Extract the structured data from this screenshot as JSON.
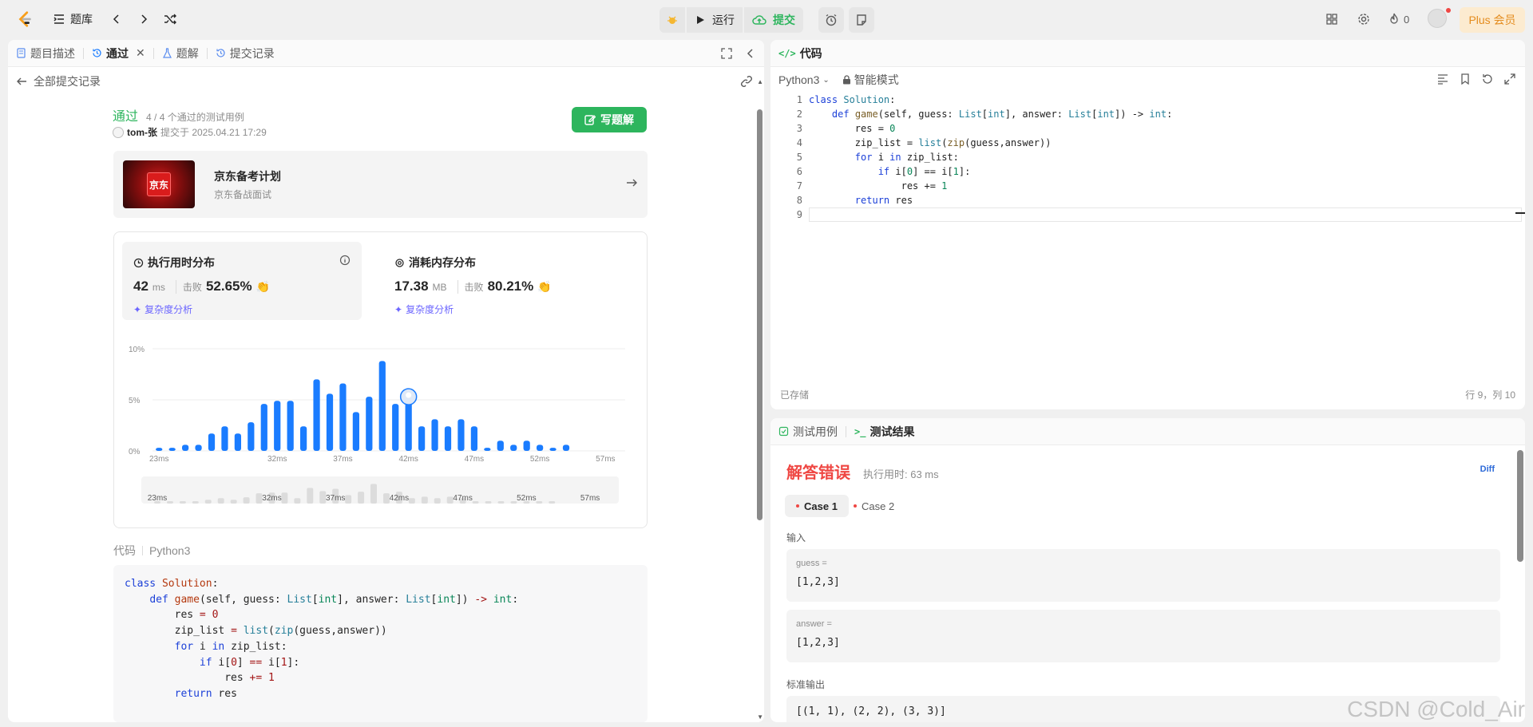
{
  "topbar": {
    "problem_list": "题库",
    "run": "运行",
    "submit": "提交",
    "streak": "0",
    "plus": "Plus 会员"
  },
  "left": {
    "tabs": [
      "题目描述",
      "通过",
      "题解",
      "提交记录"
    ],
    "back": "全部提交记录",
    "status": "通过",
    "cases": "4 / 4 个通过的测试用例",
    "user": "tom-张",
    "submitted": "提交于 2025.04.21 17:29",
    "write_solution": "写题解",
    "promo": {
      "title": "京东备考计划",
      "sub": "京东备战面试",
      "logo": "京东"
    },
    "runtime": {
      "title": "执行用时分布",
      "value": "42",
      "unit": "ms",
      "beat_label": "击败",
      "beat": "52.65%",
      "link": "复杂度分析"
    },
    "memory": {
      "title": "消耗内存分布",
      "value": "17.38",
      "unit": "MB",
      "beat_label": "击败",
      "beat": "80.21%",
      "link": "复杂度分析"
    },
    "code_label": "代码",
    "code_lang": "Python3"
  },
  "chart_data": {
    "type": "bar",
    "x": [
      "23ms",
      "24ms",
      "25ms",
      "26ms",
      "27ms",
      "28ms",
      "29ms",
      "30ms",
      "31ms",
      "32ms",
      "33ms",
      "34ms",
      "35ms",
      "36ms",
      "37ms",
      "38ms",
      "39ms",
      "40ms",
      "41ms",
      "42ms",
      "43ms",
      "44ms",
      "45ms",
      "46ms",
      "47ms",
      "48ms",
      "49ms",
      "50ms",
      "51ms",
      "52ms",
      "53ms",
      "54ms",
      "55ms",
      "56ms",
      "57ms",
      "58ms"
    ],
    "values": [
      0.3,
      0.3,
      0.6,
      0.6,
      1.7,
      2.4,
      1.7,
      2.8,
      4.6,
      4.9,
      4.9,
      2.4,
      7.0,
      5.6,
      6.6,
      3.8,
      5.3,
      8.8,
      4.6,
      5.3,
      2.4,
      3.1,
      2.4,
      3.1,
      2.4,
      0.3,
      1.0,
      0.6,
      1.0,
      0.6,
      0.3,
      0.6,
      0,
      0,
      0,
      0
    ],
    "tick_labels": [
      "23ms",
      "32ms",
      "37ms",
      "42ms",
      "47ms",
      "52ms",
      "57ms"
    ],
    "y_ticks": [
      "0%",
      "5%",
      "10%"
    ],
    "ylim": [
      0,
      10
    ],
    "marker_at": "42ms",
    "grid": true
  },
  "editor": {
    "title": "代码",
    "lang": "Python3",
    "mode": "智能模式",
    "saved": "已存储",
    "cursor": "行 9，列 10"
  },
  "test": {
    "tabs": [
      "测试用例",
      "测试结果"
    ],
    "result": "解答错误",
    "time": "执行用时: 63 ms",
    "diff": "Diff",
    "cases": [
      "Case 1",
      "Case 2"
    ],
    "input_label": "输入",
    "inputs": [
      {
        "name": "guess =",
        "value": "[1,2,3]"
      },
      {
        "name": "answer =",
        "value": "[1,2,3]"
      }
    ],
    "stdout_label": "标准输出",
    "stdout": "[(1, 1), (2, 2), (3, 3)]"
  },
  "watermark": "CSDN @Cold_Air",
  "colors": {
    "accent_green": "#2db55d",
    "error_red": "#ef4743",
    "bar_blue": "#1a7cff",
    "link_purple": "#6b65ff"
  }
}
